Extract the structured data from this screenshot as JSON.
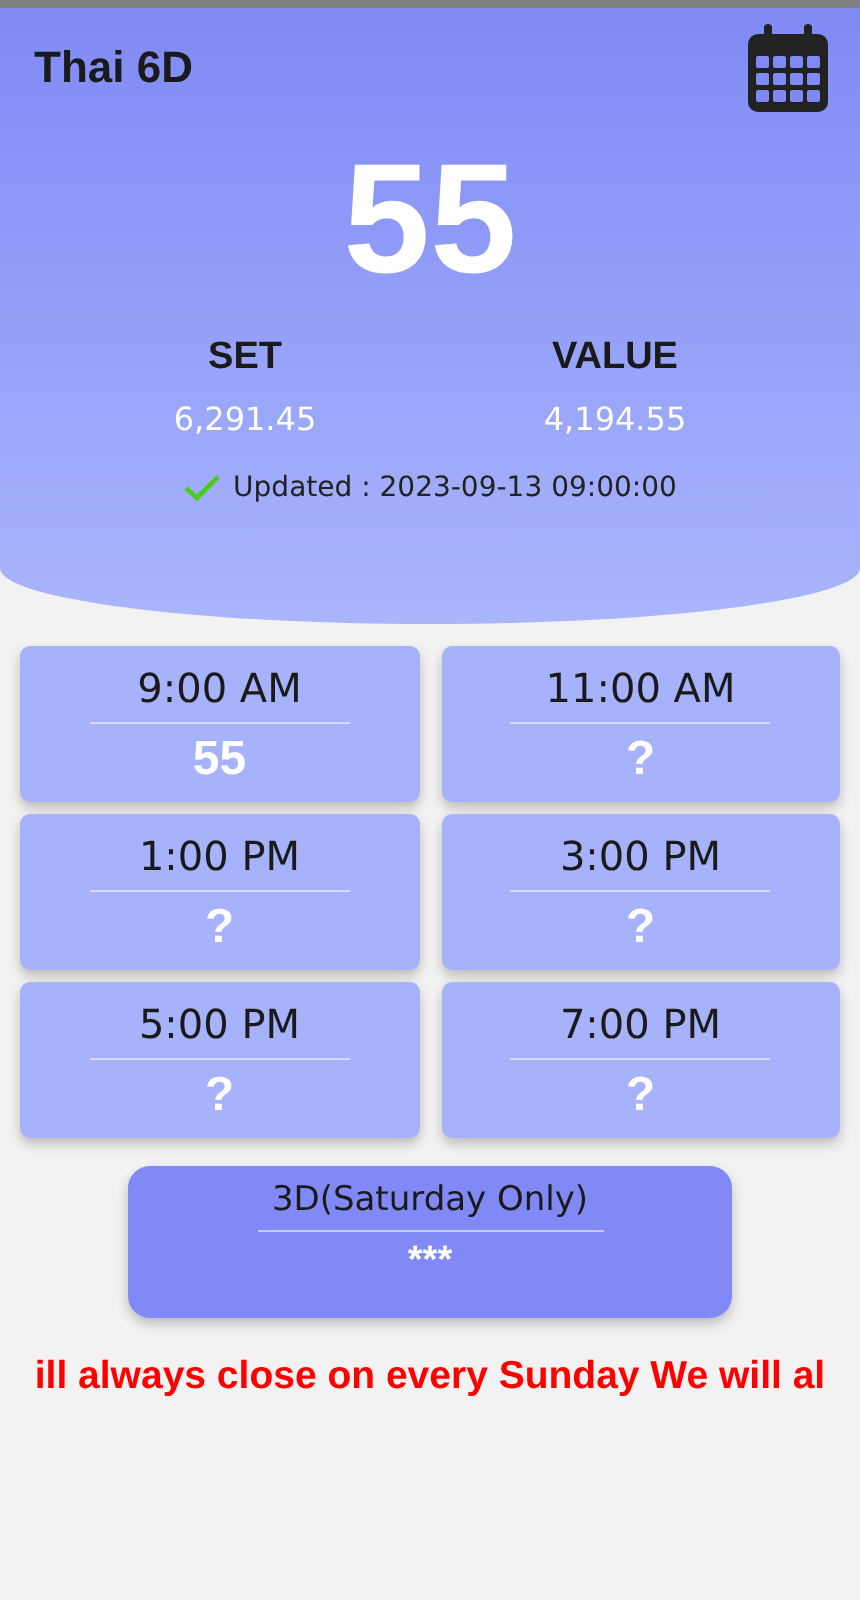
{
  "header": {
    "title": "Thai 6D",
    "main_number": "55",
    "stats": [
      {
        "label": "SET",
        "value": "6,291.45"
      },
      {
        "label": "VALUE",
        "value": "4,194.55"
      }
    ],
    "updated": "Updated : 2023-09-13 09:00:00"
  },
  "slots": [
    {
      "time": "9:00 AM",
      "result": "55"
    },
    {
      "time": "11:00 AM",
      "result": "?"
    },
    {
      "time": "1:00 PM",
      "result": "?"
    },
    {
      "time": "3:00 PM",
      "result": "?"
    },
    {
      "time": "5:00 PM",
      "result": "?"
    },
    {
      "time": "7:00 PM",
      "result": "?"
    }
  ],
  "special": {
    "title": "3D(Saturday Only)",
    "result": "***"
  },
  "ticker": "ill always close on every Sunday We will al"
}
